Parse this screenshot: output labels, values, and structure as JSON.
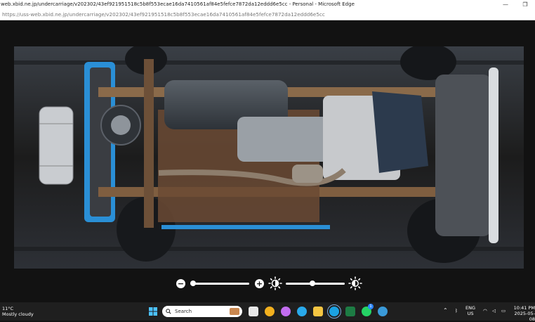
{
  "window": {
    "title": "web.xbid.ne.jp/undercarriage/v202302/43ef921951518c5b8f553ecae16da7410561af84e5fefce7872da12eddd6e5cc - Personal - Microsoft Edge",
    "url": "https://uss-web.xbid.ne.jp/undercarriage/v202302/43ef921951518c5b8f553ecae16da7410561af84e5fefce7872da12eddd6e5cc"
  },
  "viewer": {
    "zoom_slider_value": 0.1,
    "brightness_slider_value": 0.45
  },
  "taskbar": {
    "weather_temp": "11°C",
    "weather_desc": "Mostly cloudy",
    "search_placeholder": "Search",
    "lang_top": "ENG",
    "lang_bottom": "US",
    "time": "10:41 PM",
    "date": "2025-05-08",
    "whatsapp_badge": "1"
  },
  "colors": {
    "accent": "#1f6fe0",
    "taskbar_bg": "#1f1f1f",
    "viewer_bg": "#121212"
  }
}
